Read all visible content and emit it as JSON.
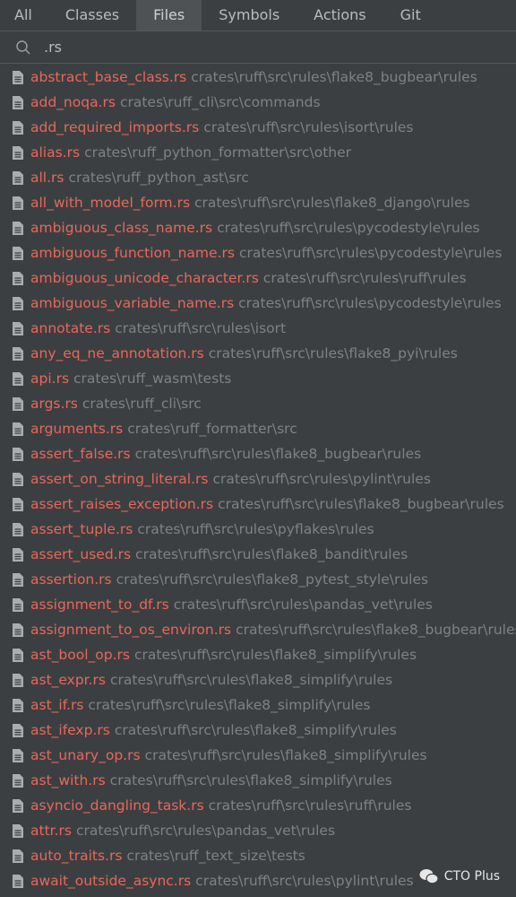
{
  "tabs": [
    {
      "label": "All",
      "active": false
    },
    {
      "label": "Classes",
      "active": false
    },
    {
      "label": "Files",
      "active": true
    },
    {
      "label": "Symbols",
      "active": false
    },
    {
      "label": "Actions",
      "active": false
    },
    {
      "label": "Git",
      "active": false
    }
  ],
  "search": {
    "value": ".rs",
    "icon": "search-icon"
  },
  "colors": {
    "background": "#3c3f41",
    "filename": "#e8675b",
    "path": "#7f8285",
    "active_tab": "#4e5254"
  },
  "results": [
    {
      "name": "abstract_base_class.rs",
      "path": "crates\\ruff\\src\\rules\\flake8_bugbear\\rules"
    },
    {
      "name": "add_noqa.rs",
      "path": "crates\\ruff_cli\\src\\commands"
    },
    {
      "name": "add_required_imports.rs",
      "path": "crates\\ruff\\src\\rules\\isort\\rules"
    },
    {
      "name": "alias.rs",
      "path": "crates\\ruff_python_formatter\\src\\other"
    },
    {
      "name": "all.rs",
      "path": "crates\\ruff_python_ast\\src"
    },
    {
      "name": "all_with_model_form.rs",
      "path": "crates\\ruff\\src\\rules\\flake8_django\\rules"
    },
    {
      "name": "ambiguous_class_name.rs",
      "path": "crates\\ruff\\src\\rules\\pycodestyle\\rules"
    },
    {
      "name": "ambiguous_function_name.rs",
      "path": "crates\\ruff\\src\\rules\\pycodestyle\\rules"
    },
    {
      "name": "ambiguous_unicode_character.rs",
      "path": "crates\\ruff\\src\\rules\\ruff\\rules"
    },
    {
      "name": "ambiguous_variable_name.rs",
      "path": "crates\\ruff\\src\\rules\\pycodestyle\\rules"
    },
    {
      "name": "annotate.rs",
      "path": "crates\\ruff\\src\\rules\\isort"
    },
    {
      "name": "any_eq_ne_annotation.rs",
      "path": "crates\\ruff\\src\\rules\\flake8_pyi\\rules"
    },
    {
      "name": "api.rs",
      "path": "crates\\ruff_wasm\\tests"
    },
    {
      "name": "args.rs",
      "path": "crates\\ruff_cli\\src"
    },
    {
      "name": "arguments.rs",
      "path": "crates\\ruff_formatter\\src"
    },
    {
      "name": "assert_false.rs",
      "path": "crates\\ruff\\src\\rules\\flake8_bugbear\\rules"
    },
    {
      "name": "assert_on_string_literal.rs",
      "path": "crates\\ruff\\src\\rules\\pylint\\rules"
    },
    {
      "name": "assert_raises_exception.rs",
      "path": "crates\\ruff\\src\\rules\\flake8_bugbear\\rules"
    },
    {
      "name": "assert_tuple.rs",
      "path": "crates\\ruff\\src\\rules\\pyflakes\\rules"
    },
    {
      "name": "assert_used.rs",
      "path": "crates\\ruff\\src\\rules\\flake8_bandit\\rules"
    },
    {
      "name": "assertion.rs",
      "path": "crates\\ruff\\src\\rules\\flake8_pytest_style\\rules"
    },
    {
      "name": "assignment_to_df.rs",
      "path": "crates\\ruff\\src\\rules\\pandas_vet\\rules"
    },
    {
      "name": "assignment_to_os_environ.rs",
      "path": "crates\\ruff\\src\\rules\\flake8_bugbear\\rules"
    },
    {
      "name": "ast_bool_op.rs",
      "path": "crates\\ruff\\src\\rules\\flake8_simplify\\rules"
    },
    {
      "name": "ast_expr.rs",
      "path": "crates\\ruff\\src\\rules\\flake8_simplify\\rules"
    },
    {
      "name": "ast_if.rs",
      "path": "crates\\ruff\\src\\rules\\flake8_simplify\\rules"
    },
    {
      "name": "ast_ifexp.rs",
      "path": "crates\\ruff\\src\\rules\\flake8_simplify\\rules"
    },
    {
      "name": "ast_unary_op.rs",
      "path": "crates\\ruff\\src\\rules\\flake8_simplify\\rules"
    },
    {
      "name": "ast_with.rs",
      "path": "crates\\ruff\\src\\rules\\flake8_simplify\\rules"
    },
    {
      "name": "asyncio_dangling_task.rs",
      "path": "crates\\ruff\\src\\rules\\ruff\\rules"
    },
    {
      "name": "attr.rs",
      "path": "crates\\ruff\\src\\rules\\pandas_vet\\rules"
    },
    {
      "name": "auto_traits.rs",
      "path": "crates\\ruff_text_size\\tests"
    },
    {
      "name": "await_outside_async.rs",
      "path": "crates\\ruff\\src\\rules\\pylint\\rules"
    }
  ],
  "watermark": {
    "label": "CTO Plus"
  }
}
